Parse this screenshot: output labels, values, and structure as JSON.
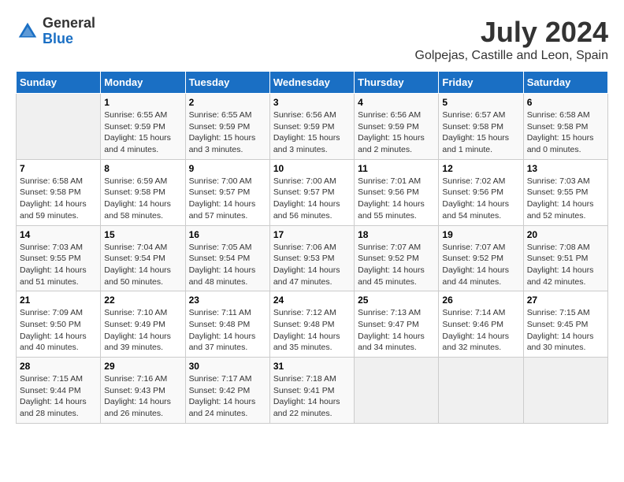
{
  "logo": {
    "general": "General",
    "blue": "Blue"
  },
  "title": "July 2024",
  "subtitle": "Golpejas, Castille and Leon, Spain",
  "days_header": [
    "Sunday",
    "Monday",
    "Tuesday",
    "Wednesday",
    "Thursday",
    "Friday",
    "Saturday"
  ],
  "weeks": [
    [
      {
        "day": "",
        "info": ""
      },
      {
        "day": "1",
        "info": "Sunrise: 6:55 AM\nSunset: 9:59 PM\nDaylight: 15 hours\nand 4 minutes."
      },
      {
        "day": "2",
        "info": "Sunrise: 6:55 AM\nSunset: 9:59 PM\nDaylight: 15 hours\nand 3 minutes."
      },
      {
        "day": "3",
        "info": "Sunrise: 6:56 AM\nSunset: 9:59 PM\nDaylight: 15 hours\nand 3 minutes."
      },
      {
        "day": "4",
        "info": "Sunrise: 6:56 AM\nSunset: 9:59 PM\nDaylight: 15 hours\nand 2 minutes."
      },
      {
        "day": "5",
        "info": "Sunrise: 6:57 AM\nSunset: 9:58 PM\nDaylight: 15 hours\nand 1 minute."
      },
      {
        "day": "6",
        "info": "Sunrise: 6:58 AM\nSunset: 9:58 PM\nDaylight: 15 hours\nand 0 minutes."
      }
    ],
    [
      {
        "day": "7",
        "info": "Sunrise: 6:58 AM\nSunset: 9:58 PM\nDaylight: 14 hours\nand 59 minutes."
      },
      {
        "day": "8",
        "info": "Sunrise: 6:59 AM\nSunset: 9:58 PM\nDaylight: 14 hours\nand 58 minutes."
      },
      {
        "day": "9",
        "info": "Sunrise: 7:00 AM\nSunset: 9:57 PM\nDaylight: 14 hours\nand 57 minutes."
      },
      {
        "day": "10",
        "info": "Sunrise: 7:00 AM\nSunset: 9:57 PM\nDaylight: 14 hours\nand 56 minutes."
      },
      {
        "day": "11",
        "info": "Sunrise: 7:01 AM\nSunset: 9:56 PM\nDaylight: 14 hours\nand 55 minutes."
      },
      {
        "day": "12",
        "info": "Sunrise: 7:02 AM\nSunset: 9:56 PM\nDaylight: 14 hours\nand 54 minutes."
      },
      {
        "day": "13",
        "info": "Sunrise: 7:03 AM\nSunset: 9:55 PM\nDaylight: 14 hours\nand 52 minutes."
      }
    ],
    [
      {
        "day": "14",
        "info": "Sunrise: 7:03 AM\nSunset: 9:55 PM\nDaylight: 14 hours\nand 51 minutes."
      },
      {
        "day": "15",
        "info": "Sunrise: 7:04 AM\nSunset: 9:54 PM\nDaylight: 14 hours\nand 50 minutes."
      },
      {
        "day": "16",
        "info": "Sunrise: 7:05 AM\nSunset: 9:54 PM\nDaylight: 14 hours\nand 48 minutes."
      },
      {
        "day": "17",
        "info": "Sunrise: 7:06 AM\nSunset: 9:53 PM\nDaylight: 14 hours\nand 47 minutes."
      },
      {
        "day": "18",
        "info": "Sunrise: 7:07 AM\nSunset: 9:52 PM\nDaylight: 14 hours\nand 45 minutes."
      },
      {
        "day": "19",
        "info": "Sunrise: 7:07 AM\nSunset: 9:52 PM\nDaylight: 14 hours\nand 44 minutes."
      },
      {
        "day": "20",
        "info": "Sunrise: 7:08 AM\nSunset: 9:51 PM\nDaylight: 14 hours\nand 42 minutes."
      }
    ],
    [
      {
        "day": "21",
        "info": "Sunrise: 7:09 AM\nSunset: 9:50 PM\nDaylight: 14 hours\nand 40 minutes."
      },
      {
        "day": "22",
        "info": "Sunrise: 7:10 AM\nSunset: 9:49 PM\nDaylight: 14 hours\nand 39 minutes."
      },
      {
        "day": "23",
        "info": "Sunrise: 7:11 AM\nSunset: 9:48 PM\nDaylight: 14 hours\nand 37 minutes."
      },
      {
        "day": "24",
        "info": "Sunrise: 7:12 AM\nSunset: 9:48 PM\nDaylight: 14 hours\nand 35 minutes."
      },
      {
        "day": "25",
        "info": "Sunrise: 7:13 AM\nSunset: 9:47 PM\nDaylight: 14 hours\nand 34 minutes."
      },
      {
        "day": "26",
        "info": "Sunrise: 7:14 AM\nSunset: 9:46 PM\nDaylight: 14 hours\nand 32 minutes."
      },
      {
        "day": "27",
        "info": "Sunrise: 7:15 AM\nSunset: 9:45 PM\nDaylight: 14 hours\nand 30 minutes."
      }
    ],
    [
      {
        "day": "28",
        "info": "Sunrise: 7:15 AM\nSunset: 9:44 PM\nDaylight: 14 hours\nand 28 minutes."
      },
      {
        "day": "29",
        "info": "Sunrise: 7:16 AM\nSunset: 9:43 PM\nDaylight: 14 hours\nand 26 minutes."
      },
      {
        "day": "30",
        "info": "Sunrise: 7:17 AM\nSunset: 9:42 PM\nDaylight: 14 hours\nand 24 minutes."
      },
      {
        "day": "31",
        "info": "Sunrise: 7:18 AM\nSunset: 9:41 PM\nDaylight: 14 hours\nand 22 minutes."
      },
      {
        "day": "",
        "info": ""
      },
      {
        "day": "",
        "info": ""
      },
      {
        "day": "",
        "info": ""
      }
    ]
  ]
}
